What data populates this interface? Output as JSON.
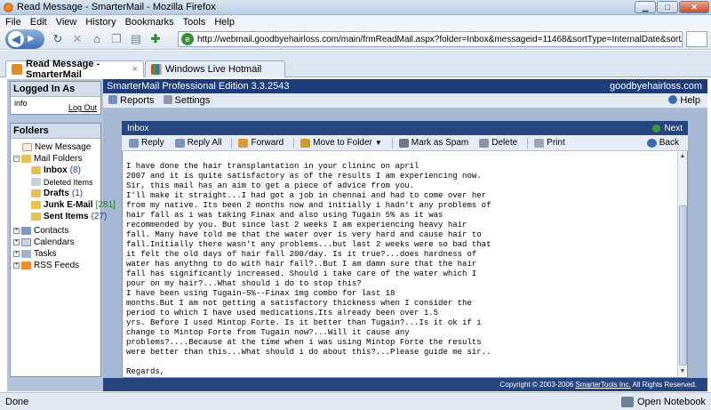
{
  "window": {
    "title": "Read Message - SmarterMail - Mozilla Firefox"
  },
  "menu": [
    "File",
    "Edit",
    "View",
    "History",
    "Bookmarks",
    "Tools",
    "Help"
  ],
  "url": "http://webmail.goodbyehairloss.com/main/frmReadMail.aspx?folder=Inbox&messageid=11468&sortType=InternalDate&sortAscending=False&adv=true&adv",
  "tabs": [
    {
      "label": "Read Message - SmarterMail"
    },
    {
      "label": "Windows Live Hotmail"
    }
  ],
  "app": {
    "edition": "SmarterMail Professional Edition 3.3.2543",
    "domain": "goodbyehairloss.com",
    "reports": "Reports",
    "settings": "Settings",
    "help": "Help"
  },
  "left": {
    "logged_in_title": "Logged In As",
    "user": "info",
    "logout": "Log Out",
    "folders_title": "Folders",
    "new_message": "New Message",
    "mail_folders": "Mail Folders",
    "inbox": "Inbox",
    "inbox_count": "(8)",
    "deleted": "Deleted Items",
    "drafts": "Drafts",
    "drafts_count": "(1)",
    "junk": "Junk E-Mail",
    "junk_count": "[281]",
    "sent": "Sent Items",
    "sent_count": "(27)",
    "contacts": "Contacts",
    "calendars": "Calendars",
    "tasks": "Tasks",
    "rss": "RSS Feeds"
  },
  "message": {
    "header": "Inbox",
    "next": "Next",
    "back": "Back",
    "toolbar": {
      "reply": "Reply",
      "reply_all": "Reply All",
      "forward": "Forward",
      "move": "Move to Folder",
      "spam": "Mark as Spam",
      "delete": "Delete",
      "print": "Print"
    },
    "body": "I have done the hair transplantation in your clininc on april\n2007 and it is quite satisfactory as of the results I am experiencing now.\nSir, this mail has an aim to get a piece of advice from you.\nI'll make it straight...I had got a job in chennai and had to come over her\nfrom my native. Its been 2 months now and initially i hadn't any problems of\nhair fall as i was taking Finax and also using Tugain 5% as it was\nrecommended by you. But since last 2 weeks I am experiencing heavy hair\nfall. Many have told me that the water over is very hard and cause hair to\nfall.Initially there wasn't any problems...but last 2 weeks were so bad that\nit felt the old days of hair fall 200/day. Is it true?...does hardness of\nwater has anythng to do with hair fall?..But I am damn sure that the hair\nfall has significantly increased. Should i take care of the water which I\npour on my hair?...What should i do to stop this?\nI have been using Tugain-5%--Finax 1mg combo for last 18\nmonths.But I am not getting a satisfactory thickness when I consider the\nperiod to which I have used medications.Its already been over 1.5\nyrs. Before I used Mintop Forte. Is it better than Tugain?...Is it ok if i\nchange to Mintop Forte from Tugain now?...Will it cause any\nproblems?....Because at the time when i was using Mintop Forte the results\nwere better than this...What should i do about this?...Please guide me sir..\n\nRegards,\nVivek.B"
  },
  "footer": {
    "copyright": "Copyright © 2003-2006 ",
    "company": "SmarterTools Inc.",
    "rights": " All Rights Reserved."
  },
  "status": {
    "left": "Done",
    "right": "Open Notebook"
  }
}
